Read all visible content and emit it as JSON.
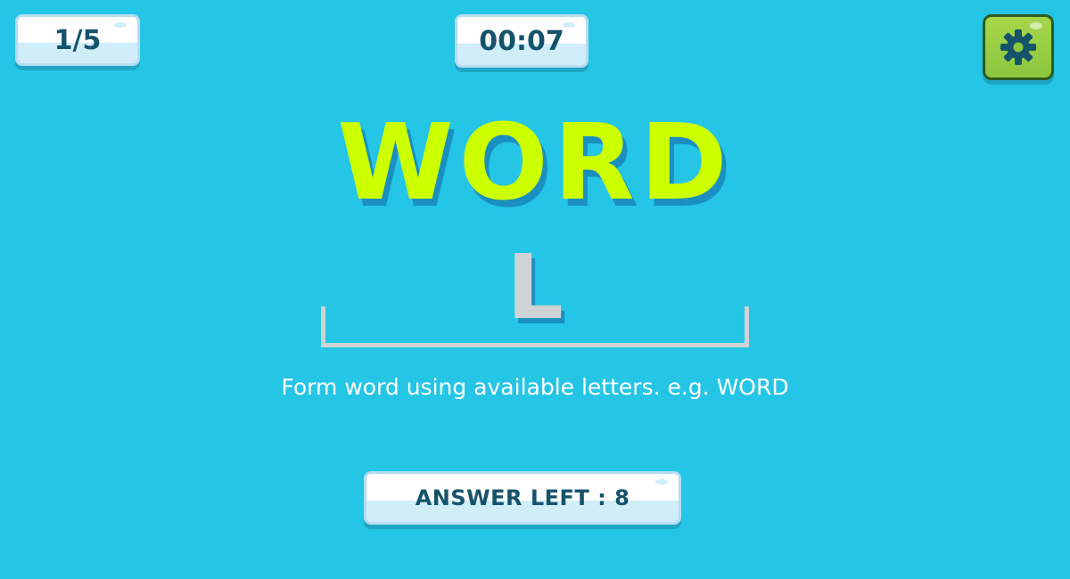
{
  "hud": {
    "level": "1/5",
    "timer": "00:07",
    "settings_icon": "gear-icon"
  },
  "puzzle": {
    "title_word": "WORD",
    "typed_letters": "L",
    "hint": "Form word using available letters. e.g. WORD"
  },
  "footer": {
    "answers_left": "ANSWER LEFT : 8"
  },
  "colors": {
    "background": "#25c5e6",
    "title_word": "#ccff00",
    "panel_text": "#15536b",
    "settings_button": "#8cc63f"
  }
}
